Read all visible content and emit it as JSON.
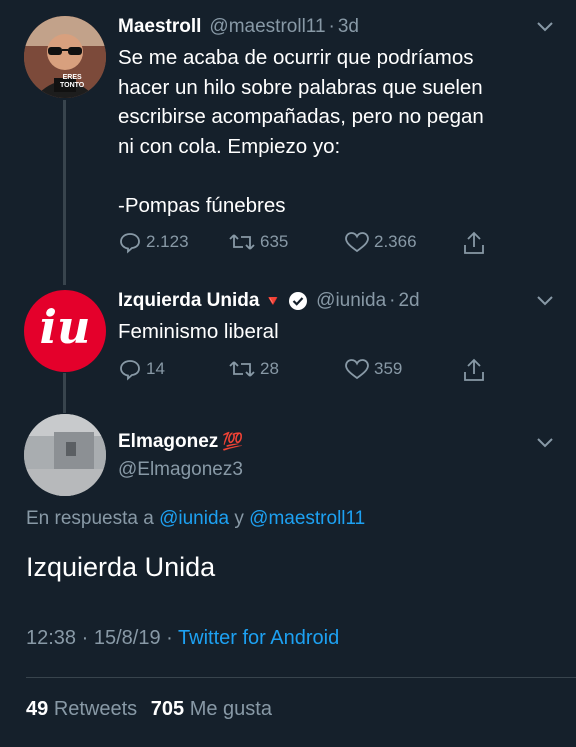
{
  "tweets": [
    {
      "name": "Maestroll",
      "handle": "@maestroll11",
      "sep": "·",
      "time": "3d",
      "text": "Se me acaba de ocurrir que podríamos\nhacer un hilo sobre palabras que suelen\nescribirse acompañadas, pero no pegan\nni con cola. Empiezo yo:\n\n-Pompas fúnebres",
      "avatar_badge": "ERES\nTONTO",
      "replies": "2.123",
      "retweets": "635",
      "likes": "2.366"
    },
    {
      "name": "Izquierda Unida",
      "name_emoji": "🔻",
      "verified": true,
      "handle": "@iunida",
      "sep": "·",
      "time": "2d",
      "text": "Feminismo liberal",
      "avatar_logo": "iu",
      "replies": "14",
      "retweets": "28",
      "likes": "359"
    }
  ],
  "main_tweet": {
    "name": "Elmagonez",
    "name_emoji": "💯",
    "handle": "@Elmagonez3",
    "reply_prefix": "En respuesta a",
    "reply_user1": "@iunida",
    "reply_conj": "y",
    "reply_user2": "@maestroll11",
    "text": "Izquierda Unida",
    "time": "12:38",
    "date": "15/8/19",
    "sep": "·",
    "source": "Twitter for Android",
    "retweet_count": "49",
    "retweet_label": "Retweets",
    "like_count": "705",
    "like_label": "Me gusta"
  },
  "colors": {
    "background": "#15202b",
    "muted": "#8899a6",
    "link": "#1da1f2",
    "iu_red": "#e4002b"
  },
  "icons": [
    "chevron-down-icon",
    "reply-icon",
    "retweet-icon",
    "like-icon",
    "share-icon",
    "verified-icon"
  ]
}
